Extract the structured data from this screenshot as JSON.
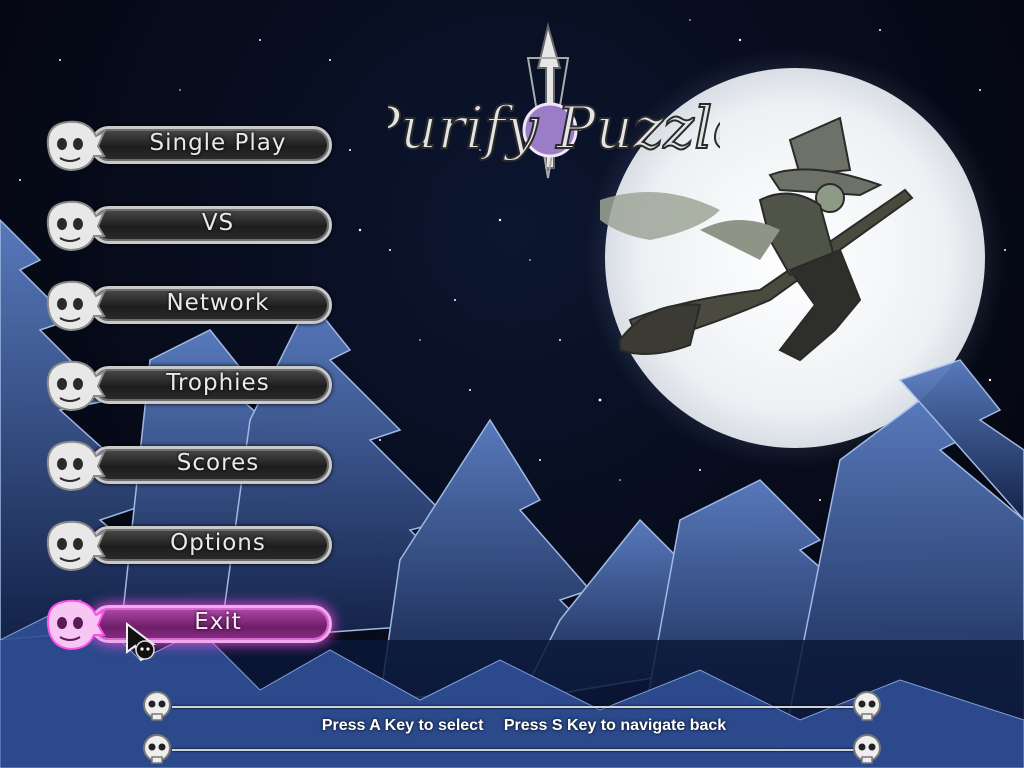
{
  "game": {
    "logo_text": "Purify Puzzle"
  },
  "menu": {
    "items": [
      {
        "label": "Single Play",
        "selected": false
      },
      {
        "label": "VS",
        "selected": false
      },
      {
        "label": "Network",
        "selected": false
      },
      {
        "label": "Trophies",
        "selected": false
      },
      {
        "label": "Scores",
        "selected": false
      },
      {
        "label": "Options",
        "selected": false
      },
      {
        "label": "Exit",
        "selected": true
      }
    ]
  },
  "help": {
    "select_hint": "Press A Key to select",
    "back_hint": "Press S Key to navigate back"
  },
  "colors": {
    "selected_glow": "#ff4fe8",
    "button_border": "#c9c9c9",
    "moon": "#f4f6f8",
    "night_sky": "#070b1a",
    "trees": "#2a4a8c"
  },
  "icons": [
    "skull-icon",
    "cursor-icon",
    "moon-icon",
    "witch-icon"
  ]
}
